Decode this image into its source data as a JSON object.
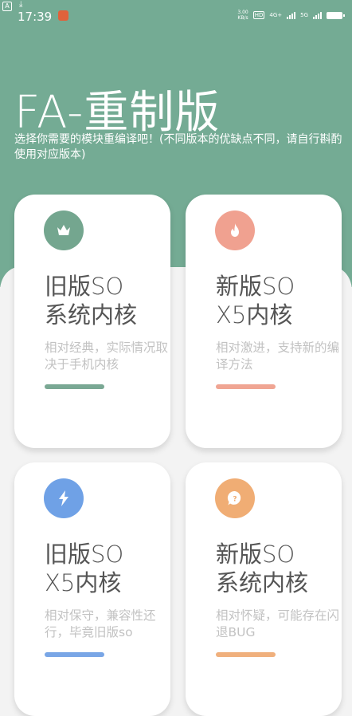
{
  "status_bar": {
    "badge": "A",
    "time": "17:39",
    "speed_value": "3.00",
    "speed_unit": "KB/s",
    "hd": "HD",
    "net1": "4G+",
    "net2": "5G"
  },
  "header": {
    "title": "FA-重制版",
    "subtitle": "选择你需要的模块重编译吧！(不同版本的优缺点不同，请自行斟酌使用对应版本)"
  },
  "cards": [
    {
      "title": "旧版SO\n系统内核",
      "desc": "相对经典，实际情况取决于手机内核",
      "icon": "crown-icon",
      "circle_color": "#74a68f",
      "bar_color": "#7aa894"
    },
    {
      "title": "新版SO\nX5内核",
      "desc": "相对激进，支持新的编译方法",
      "icon": "flame-icon",
      "circle_color": "#f0a190",
      "bar_color": "#f0a593"
    },
    {
      "title": "旧版SO\nX5内核",
      "desc": "相对保守，兼容性还行，毕竟旧版so",
      "icon": "lightning-icon",
      "circle_color": "#6fa1e6",
      "bar_color": "#79a6e6"
    },
    {
      "title": "新版SO\n系统内核",
      "desc": "相对怀疑，可能存在闪退BUG",
      "icon": "question-bubble-icon",
      "circle_color": "#f0ad74",
      "bar_color": "#f0b07d"
    }
  ]
}
